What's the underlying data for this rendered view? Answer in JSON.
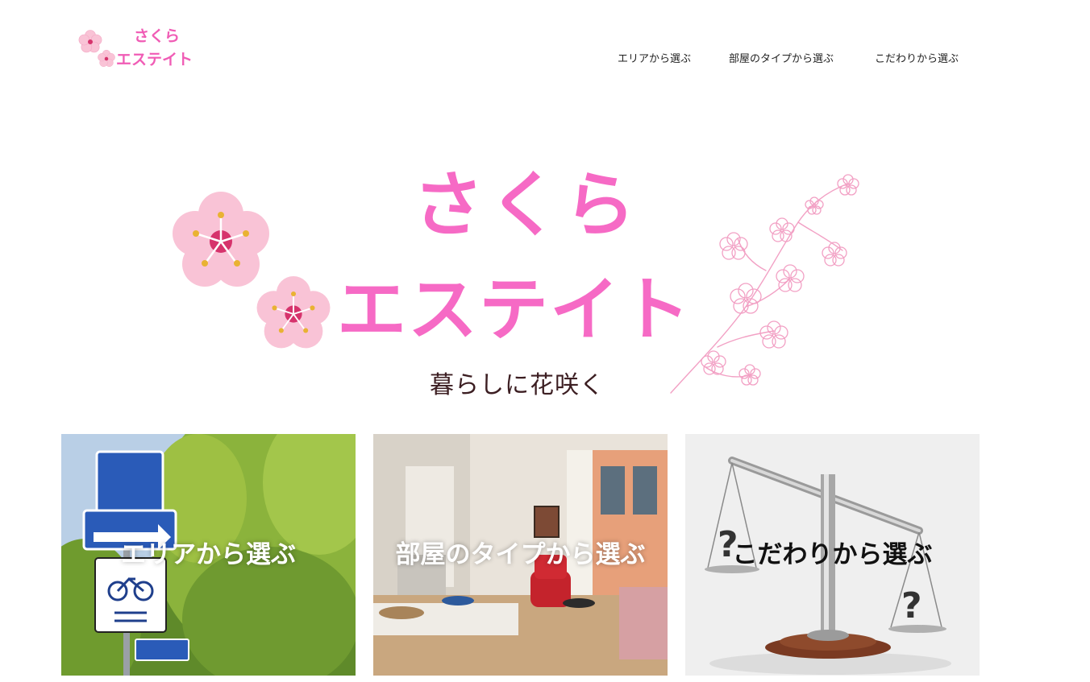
{
  "header": {
    "logo": {
      "line1": "さくら",
      "line2": "エステイト"
    },
    "nav": [
      {
        "label": "エリアから選ぶ"
      },
      {
        "label": "部屋のタイプから選ぶ"
      },
      {
        "label": "こだわりから選ぶ"
      }
    ]
  },
  "hero": {
    "title_line1": "さくら",
    "title_line2": "エステイト",
    "tagline": "暮らしに花咲く"
  },
  "cards": [
    {
      "label": "エリアから選ぶ",
      "image": "street-signs-photo",
      "label_color": "#ffffff"
    },
    {
      "label": "部屋のタイプから選ぶ",
      "image": "living-room-photo",
      "label_color": "#ffffff"
    },
    {
      "label": "こだわりから選ぶ",
      "image": "balance-scale-photo",
      "label_color": "#111111"
    }
  ],
  "colors": {
    "brand_pink": "#f66ac5",
    "blossom_pink": "#f9c3d6",
    "blossom_center": "#d6336c",
    "stamen_gold": "#e9b233",
    "tagline_brown": "#3c1e22"
  }
}
